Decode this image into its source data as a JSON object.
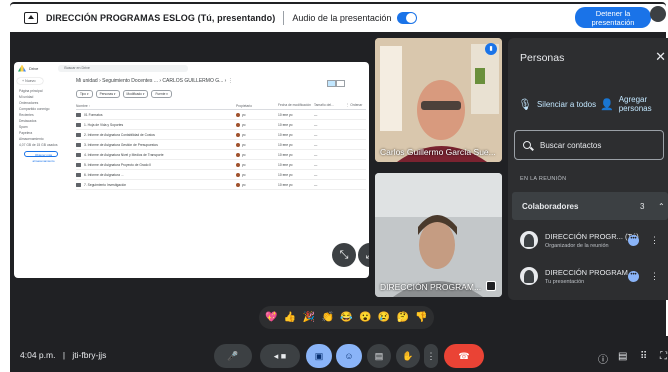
{
  "topbar": {
    "meeting_title": "DIRECCIÓN PROGRAMAS ESLOG (Tú, presentando)",
    "audio_label": "Audio de la presentación",
    "stop_presenting_label": "Detener la presentación",
    "audio_toggle_on": true
  },
  "shared_screen": {
    "drive_app_name": "Drive",
    "search_placeholder": "Buscar en Drive",
    "new_button": "+ Nuevo",
    "left_nav": [
      "Página principal",
      "Mi unidad",
      "Ordenadores",
      "Compartido conmigo",
      "Recientes",
      "Destacados",
      "Spam",
      "Papelera",
      "Almacenamiento",
      "4,07 GB de 15 GB usados"
    ],
    "store_button": "Obtener más almacenamiento",
    "breadcrumb": "Mi unidad  ›  Seguimiento Docentes ...  ›  CARLOS GUILLERMO G...  ›  ⋮",
    "filter_chips": [
      "Tipo ▾",
      "Personas ▾",
      "Modificado ▾",
      "Fuente ▾"
    ],
    "columns": [
      "Nombre ↑",
      "Propietario",
      "Fecha de modificación",
      "Tamaño del...",
      "⋮ Ordenar"
    ],
    "rows": [
      {
        "name": "01 Formatos",
        "owner": "yo",
        "modified": "10 ene yo",
        "size": "—"
      },
      {
        "name": "1. Hoja de Vida y Soportes",
        "owner": "yo",
        "modified": "10 ene yo",
        "size": "—"
      },
      {
        "name": "2. Informe de Asignatura Contabilidad de Costos",
        "owner": "yo",
        "modified": "10 ene yo",
        "size": "—"
      },
      {
        "name": "3. Informe de Asignatura Gestión de Presupuestos",
        "owner": "yo",
        "modified": "10 ene yo",
        "size": "—"
      },
      {
        "name": "4. Informe de Asignatura Nivel y Medios de Transporte",
        "owner": "yo",
        "modified": "10 ene yo",
        "size": "—"
      },
      {
        "name": "5. Informe de Asignatura Proyecto de Grado II",
        "owner": "yo",
        "modified": "10 ene yo",
        "size": "—"
      },
      {
        "name": "6. Informe de Asignatura ...",
        "owner": "yo",
        "modified": "10 ene yo",
        "size": "—"
      },
      {
        "name": "7. Seguimiento Investigación",
        "owner": "yo",
        "modified": "10 ene yo",
        "size": "—"
      }
    ]
  },
  "tiles": [
    {
      "name": "Carlos Guillermo García Sue..."
    },
    {
      "name": "DIRECCIÓN PROGRAM..."
    }
  ],
  "people_panel": {
    "title": "Personas",
    "mute_all_label": "Silenciar a todos",
    "add_people_label": "Agregar personas",
    "search_placeholder": "Buscar contactos",
    "section_label": "EN LA REUNIÓN",
    "group_name": "Colaboradores",
    "group_count": "3",
    "participants": [
      {
        "name": "DIRECCIÓN PROGR... (Tú)",
        "role": "Organizador de la reunión"
      },
      {
        "name": "DIRECCIÓN PROGRAM...",
        "role": "Tu presentación"
      }
    ]
  },
  "reactions": [
    "💖",
    "👍",
    "🎉",
    "👏",
    "😂",
    "😮",
    "😢",
    "🤔",
    "👎"
  ],
  "bottom_bar": {
    "time": "4:04 p.m.",
    "meeting_code": "jti-fbry-jjs"
  },
  "colors": {
    "accent_blue": "#1a73e8",
    "light_blue": "#8ab4f8",
    "end_call_red": "#ea4335",
    "surface": "#202124"
  }
}
